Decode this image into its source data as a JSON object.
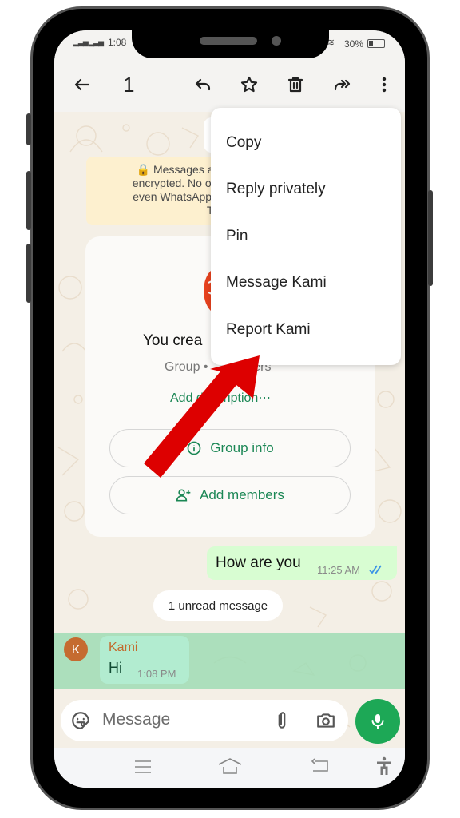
{
  "status_bar": {
    "time": "1:08",
    "battery": "30%",
    "signal_icons": [
      "signal-icon",
      "signal-icon"
    ],
    "wifi_icon": "wifi-icon",
    "battery_icon": "battery-icon"
  },
  "header": {
    "selected_count": "1",
    "icons": [
      "back-arrow-icon",
      "reply-icon",
      "star-icon",
      "delete-icon",
      "forward-icon",
      "more-vert-icon"
    ]
  },
  "encryption_notice": {
    "lines": [
      "🔒 Messages an",
      "encrypted. No one",
      "even WhatsApp, c",
      "Tap to"
    ]
  },
  "group_card": {
    "title": "You crea",
    "subtitle_left": "Group •",
    "subtitle_right": "mbers",
    "add_description": "Add description⋯",
    "group_info_label": "Group info",
    "add_members_label": "Add members"
  },
  "messages": {
    "outgoing": {
      "text": "How are you",
      "time": "11:25 AM",
      "status": "read"
    },
    "unread_divider": "1 unread message",
    "incoming": {
      "avatar_letter": "K",
      "sender": "Kami",
      "text": "Hi",
      "time": "1:08 PM"
    }
  },
  "composer": {
    "placeholder": "Message",
    "icons": [
      "sticker-icon",
      "attach-icon",
      "camera-icon",
      "mic-icon"
    ]
  },
  "context_menu": {
    "items": [
      "Copy",
      "Reply privately",
      "Pin",
      "Message Kami",
      "Report Kami"
    ]
  },
  "nav_bar": {
    "icons": [
      "recents-icon",
      "home-icon",
      "back-icon",
      "accessibility-icon"
    ]
  },
  "annotation": {
    "arrow_color": "#dd0000",
    "points_to": "Report Kami"
  },
  "colors": {
    "accent_green": "#1b8755",
    "mic_green": "#1da856",
    "outgoing_bubble": "#d8fdd2",
    "highlight_row": "#9fdcb4",
    "read_ticks": "#3b93e6"
  }
}
